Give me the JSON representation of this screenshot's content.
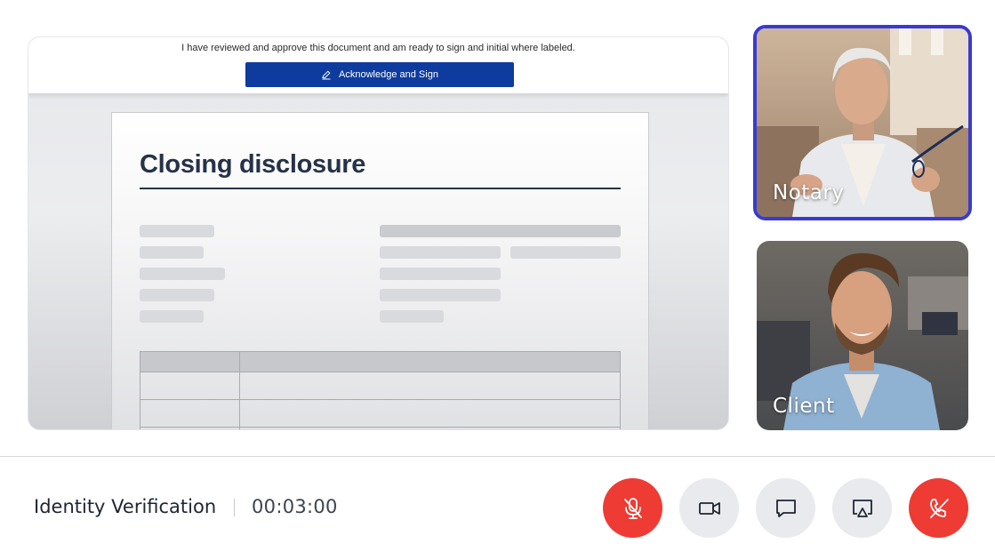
{
  "document_viewer": {
    "sign_notice": "I have reviewed and approve this document and am ready to sign and initial where labeled.",
    "acknowledge_button_label": "Acknowledge and Sign",
    "acknowledge_icon": "pen-icon",
    "document_title": "Closing disclosure"
  },
  "participants": [
    {
      "label": "Notary",
      "active_speaker": true
    },
    {
      "label": "Client",
      "active_speaker": false
    }
  ],
  "footer": {
    "session_title": "Identity Verification",
    "timer": "00:03:00"
  },
  "controls": [
    {
      "name": "mic-muted",
      "icon": "microphone-off-icon",
      "color": "#ee3b33"
    },
    {
      "name": "camera",
      "icon": "video-camera-icon",
      "color": "#e9eaee"
    },
    {
      "name": "chat",
      "icon": "chat-bubble-icon",
      "color": "#e9eaee"
    },
    {
      "name": "screen-share",
      "icon": "screen-share-icon",
      "color": "#e9eaee"
    },
    {
      "name": "end-call",
      "icon": "phone-hangup-icon",
      "color": "#ee3b33"
    }
  ],
  "colors": {
    "brand_button": "#0d3b9e",
    "active_speaker_border": "#3a3ad2",
    "danger": "#ee3b33",
    "heading": "#253248"
  }
}
